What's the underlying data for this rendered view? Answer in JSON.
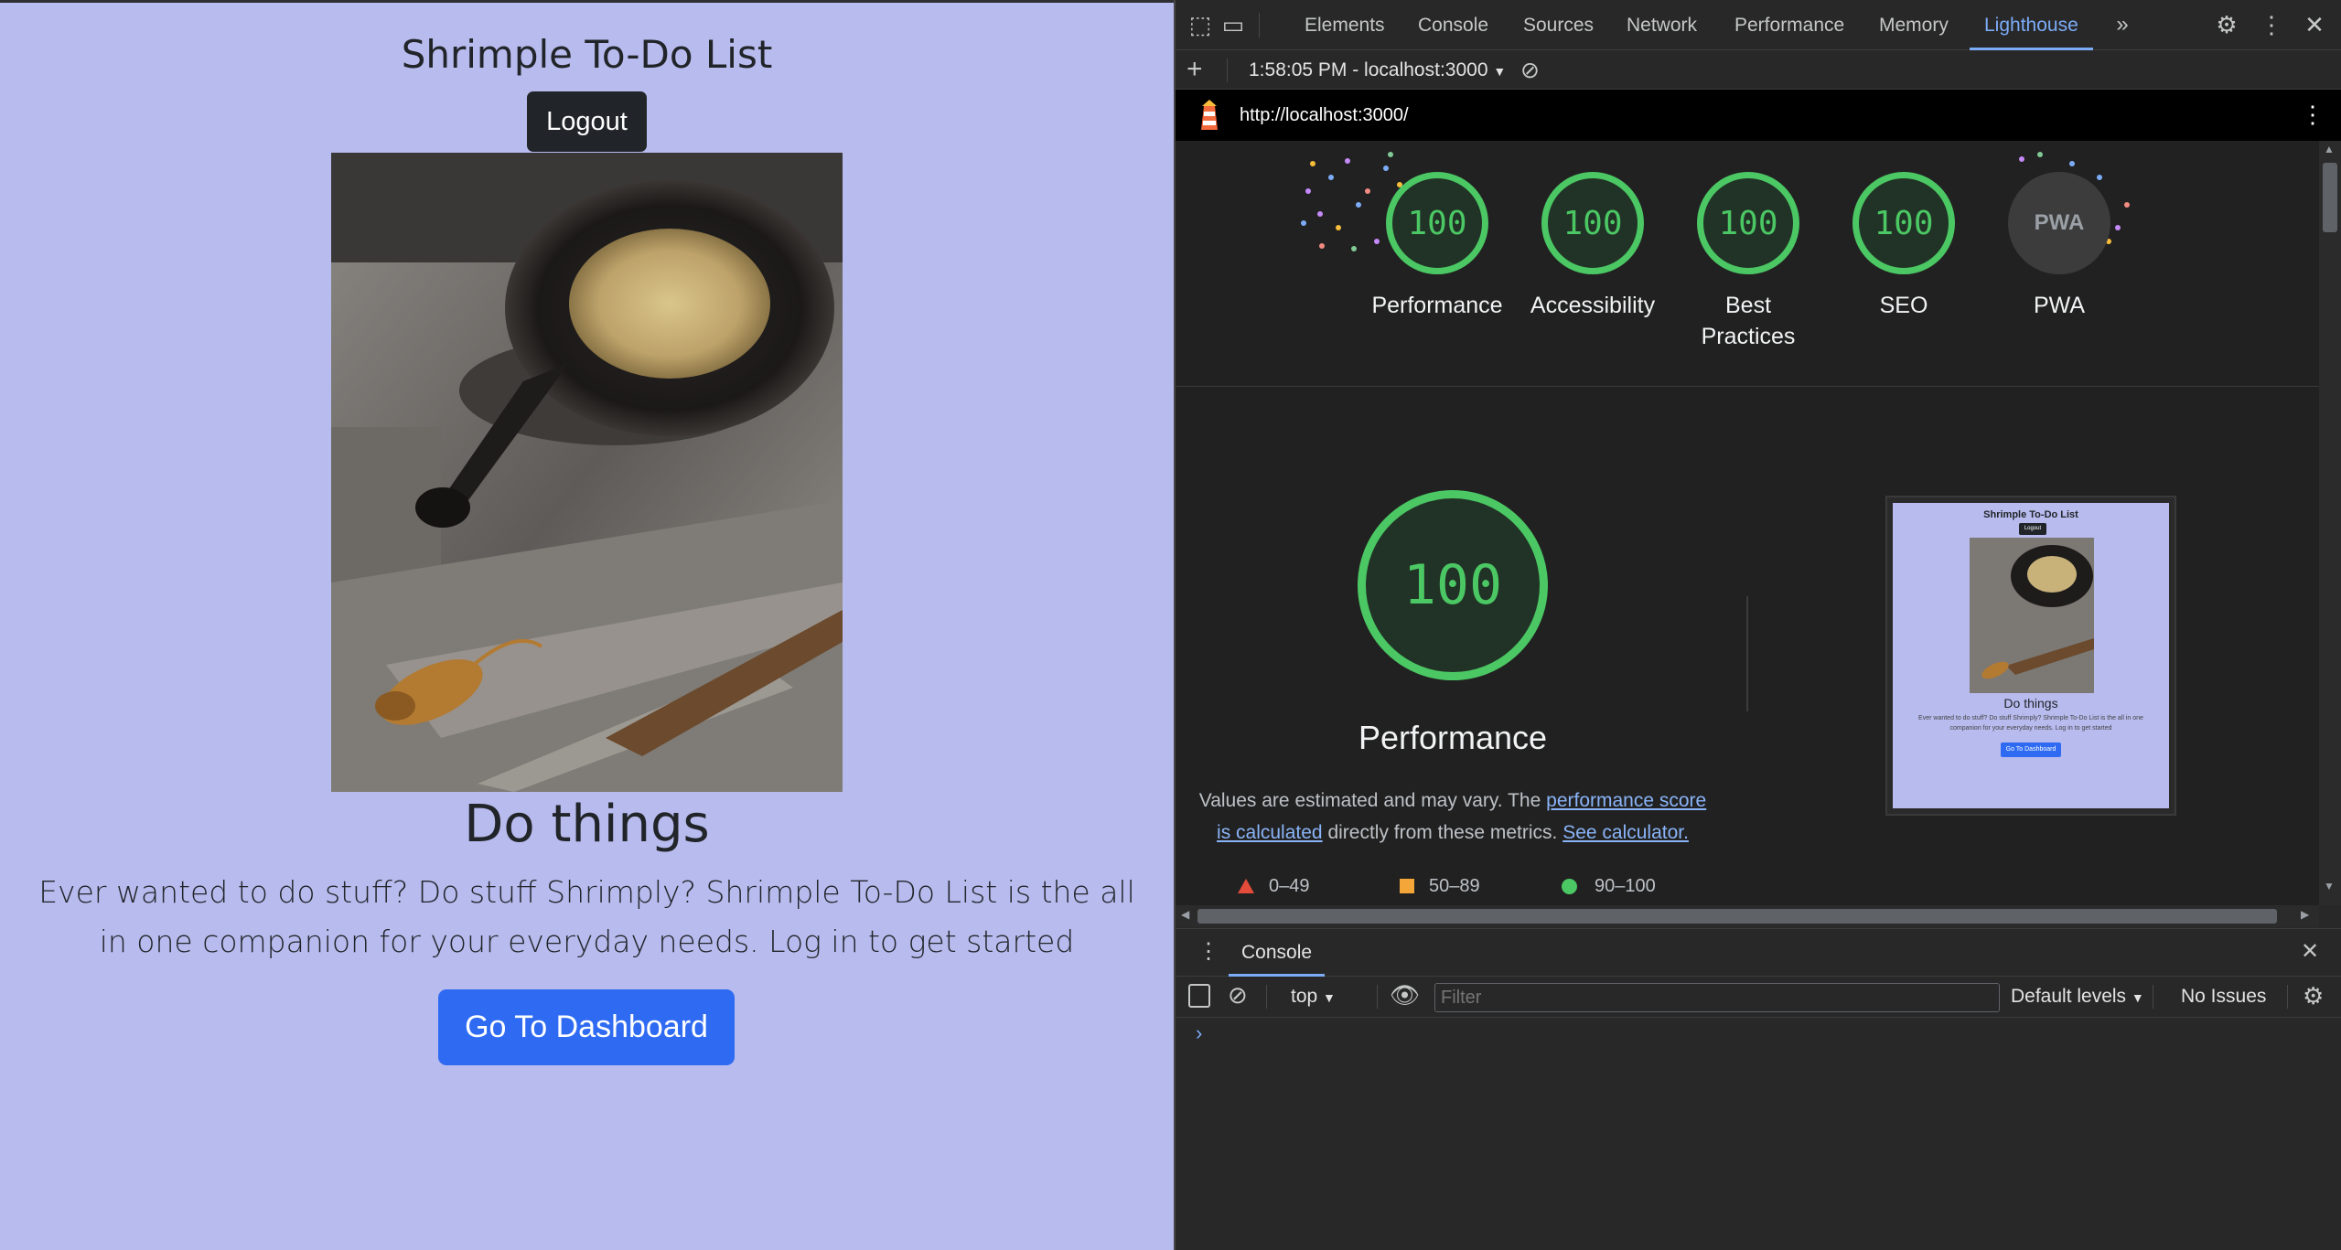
{
  "page": {
    "title": "Shrimple To-Do List",
    "logout_label": "Logout",
    "heading": "Do things",
    "lead": "Ever wanted to do stuff? Do stuff Shrimply? Shrimple To-Do List is the all in one companion for your everyday needs. Log in to get started",
    "cta_label": "Go To Dashboard",
    "background_color": "#b8bbee",
    "cta_color": "#2f6bf2"
  },
  "devtools": {
    "tabs": [
      "Elements",
      "Console",
      "Sources",
      "Network",
      "Performance",
      "Memory",
      "Lighthouse"
    ],
    "active_tab": "Lighthouse",
    "report_selector": "1:58:05 PM - localhost:3000",
    "report_url": "http://localhost:3000/",
    "categories": [
      {
        "label": "Performance",
        "score": "100"
      },
      {
        "label": "Accessibility",
        "score": "100"
      },
      {
        "label": "Best\nPractices",
        "score": "100"
      },
      {
        "label": "SEO",
        "score": "100"
      },
      {
        "label": "PWA",
        "score": "PWA"
      }
    ],
    "performance": {
      "score": "100",
      "title": "Performance",
      "note_prefix": "Values are estimated and may vary. The",
      "note_link1": "performance score is calculated",
      "note_middle": "directly from these metrics.",
      "note_link2": "See calculator.",
      "legend": [
        "0–49",
        "50–89",
        "90–100"
      ]
    },
    "thumbnail": {
      "title": "Shrimple To-Do List",
      "logout_label": "Logout",
      "heading": "Do things",
      "lead": "Ever wanted to do stuff? Do stuff Shrimply? Shrimple To-Do List is the all in one companion for your everyday needs. Log in to get started",
      "cta_label": "Go To Dashboard"
    },
    "drawer": {
      "tab": "Console",
      "context": "top",
      "filter_placeholder": "Filter",
      "levels": "Default levels",
      "issues": "No Issues"
    },
    "colors": {
      "pass": "#4bc764",
      "average": "#f4a639",
      "fail": "#e34b3a",
      "accent": "#7cacf8"
    }
  }
}
